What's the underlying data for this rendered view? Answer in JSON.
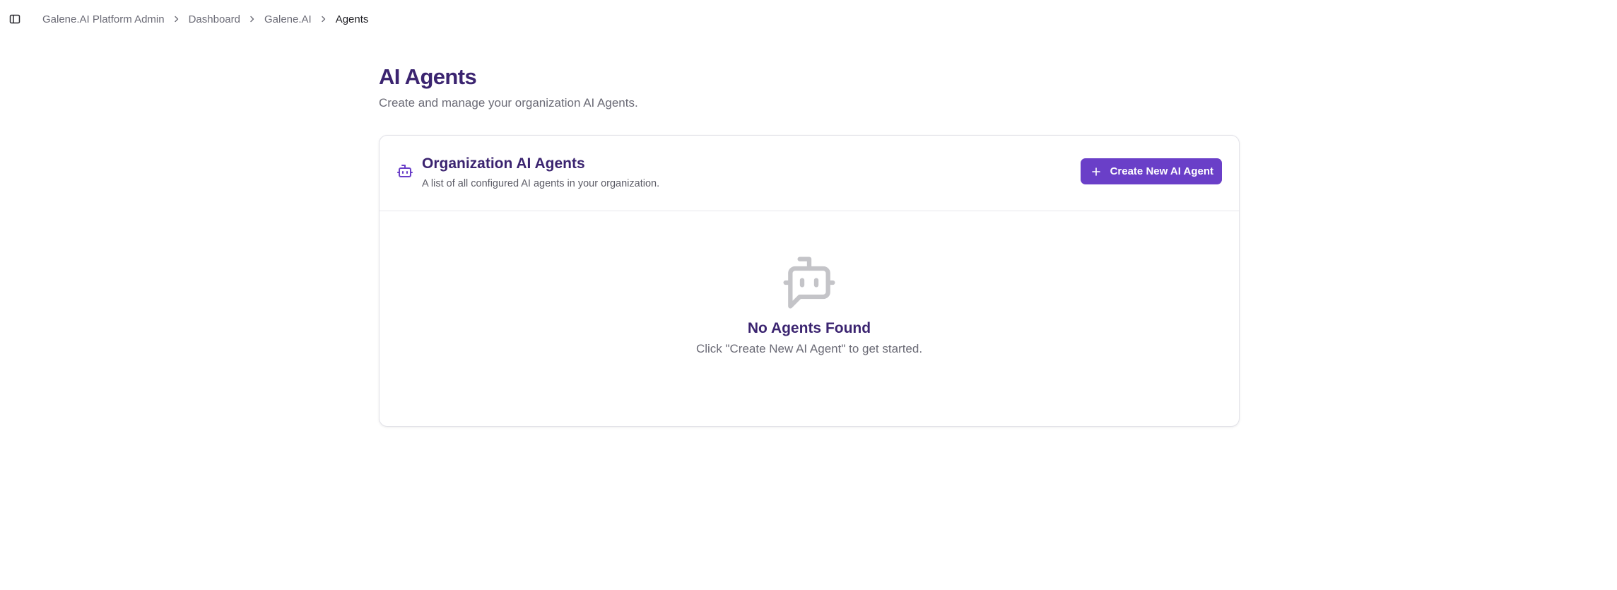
{
  "breadcrumb": {
    "items": [
      {
        "label": "Galene.AI Platform Admin"
      },
      {
        "label": "Dashboard"
      },
      {
        "label": "Galene.AI"
      }
    ],
    "current": "Agents"
  },
  "page": {
    "title": "AI Agents",
    "subtitle": "Create and manage your organization AI Agents."
  },
  "card": {
    "icon": "bot-icon",
    "title": "Organization AI Agents",
    "description": "A list of all configured AI agents in your organization.",
    "create_button_label": "Create New AI Agent"
  },
  "empty_state": {
    "icon": "bot-message-icon",
    "title": "No Agents Found",
    "description": "Click \"Create New AI Agent\" to get started."
  },
  "colors": {
    "accent": "#6a3fc8",
    "heading": "#3b2470",
    "muted_text": "#6b6b76"
  }
}
